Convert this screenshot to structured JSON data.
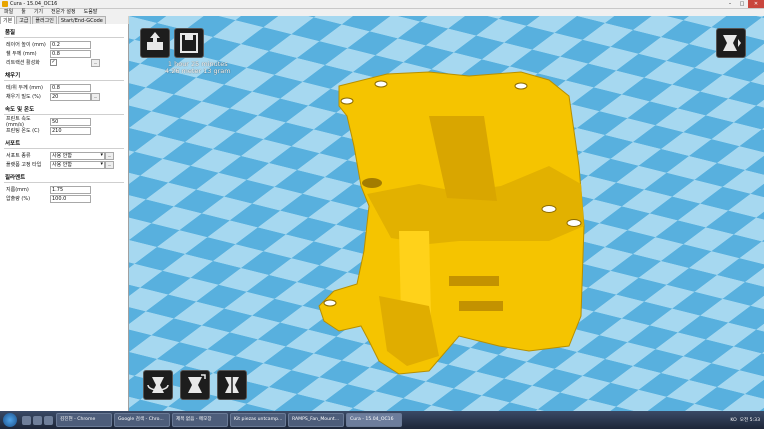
{
  "window": {
    "title": "Cura - 15.04_OC16",
    "controls": [
      "–",
      "□",
      "✕"
    ]
  },
  "menu": [
    "파일",
    "툴",
    "기기",
    "전문가 설정",
    "도움말"
  ],
  "tabs": [
    "기본",
    "고급",
    "플러그인",
    "Start/End-GCode"
  ],
  "panel": {
    "quality": {
      "title": "품질",
      "layer_height_label": "레이어 높이 (mm)",
      "layer_height": "0.2",
      "shell_label": "쉘 두께 (mm)",
      "shell": "0.8",
      "retraction_label": "리트랙션 활성화",
      "retraction": "✓"
    },
    "fill": {
      "title": "채우기",
      "bottom_top_label": "테/위 두께 (mm)",
      "bottom_top": "0.8",
      "density_label": "채우기 밀도 (%)",
      "density": "20"
    },
    "speed": {
      "title": "속도 및 온도",
      "print_speed_label": "프린트 속도 (mm/s)",
      "print_speed": "50",
      "temp_label": "프린팅 온도 (C)",
      "temp": "210"
    },
    "support": {
      "title": "서포트",
      "type_label": "서포트 종류",
      "type": "사용 안함",
      "adhesion_label": "플랫폼 고정 타입",
      "adhesion": "사용 안함"
    },
    "filament": {
      "title": "필라멘트",
      "diameter_label": "지름(mm)",
      "diameter": "1.75",
      "flow_label": "압출량 (%)",
      "flow": "100.0"
    }
  },
  "dots": "...",
  "view": {
    "print_time": "1 hour 25 minutes",
    "print_usage": "4.26 meter 13 gram",
    "model_color": "#f5c400",
    "bed_color_light": "#a6d8f0",
    "bed_color_dark": "#58b0de"
  },
  "taskbar": {
    "tasks": [
      "김진현 - Chrome",
      "Google 검색 - Chro...",
      "제목 없음 - 메모장",
      "Kit piezas untcamp...",
      "RAMPS_Fan_Mount...",
      "Cura - 15.04_OC16"
    ],
    "tray_lang": "KO",
    "clock": "오전 5:33"
  }
}
